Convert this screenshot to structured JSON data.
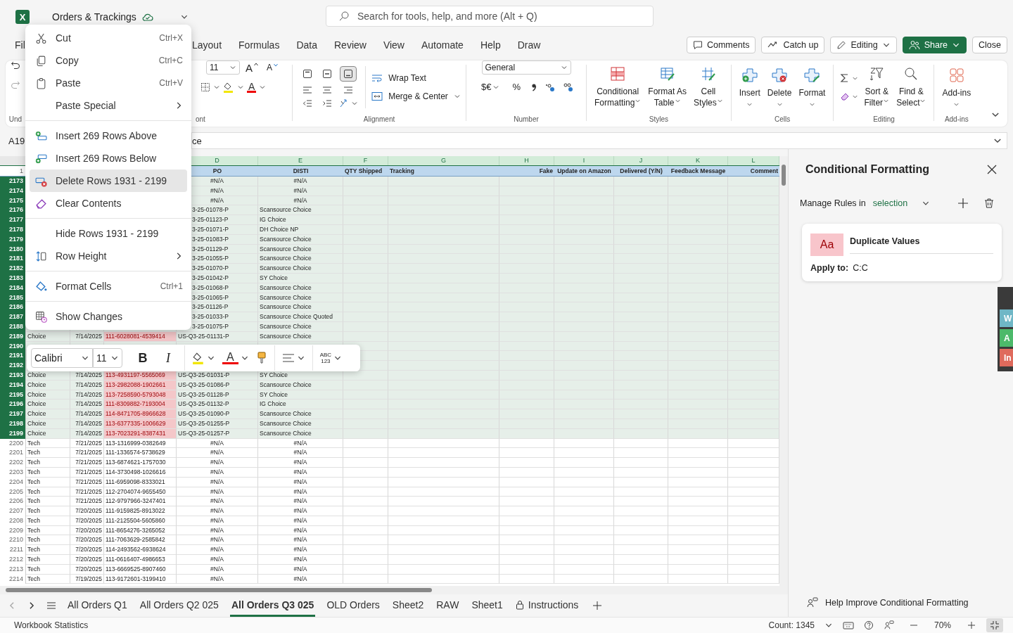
{
  "title_bar": {
    "app_logo": "X",
    "file_name": "Orders & Trackings",
    "search_placeholder": "Search for tools, help, and more (Alt + Q)"
  },
  "menu_tabs": [
    {
      "label": "Fil"
    },
    {
      "label": "Layout"
    },
    {
      "label": "Formulas"
    },
    {
      "label": "Data"
    },
    {
      "label": "Review"
    },
    {
      "label": "View"
    },
    {
      "label": "Automate"
    },
    {
      "label": "Help"
    },
    {
      "label": "Draw"
    }
  ],
  "header_buttons": [
    {
      "label": "Comments",
      "kind": "comments"
    },
    {
      "label": "Catch up",
      "kind": "catchup"
    },
    {
      "label": "Editing",
      "kind": "editing"
    },
    {
      "label": "Share",
      "kind": "share"
    },
    {
      "label": "Close",
      "kind": "close"
    }
  ],
  "ribbon": {
    "undo_label": "Und",
    "font": {
      "size": "11",
      "grow": "A",
      "shrink": "A",
      "color_letter": "A",
      "label": "ont"
    },
    "alignment": {
      "vertical": [
        {
          "selected": false
        },
        {
          "selected": false
        },
        {
          "selected": true
        }
      ],
      "wrap_text": "Wrap Text",
      "merge": "Merge & Center",
      "label": "Alignment"
    },
    "number": {
      "format": "General",
      "currency": "$€",
      "percent": "%",
      "label": "Number"
    },
    "styles": {
      "buttons": [
        {
          "line1": "Conditional",
          "line2": "Formatting"
        },
        {
          "line1": "Format As",
          "line2": "Table"
        },
        {
          "line1": "Cell",
          "line2": "Styles"
        }
      ],
      "label": "Styles"
    },
    "cells": {
      "buttons": [
        "Insert",
        "Delete",
        "Format"
      ],
      "label": "Cells"
    },
    "editing": {
      "buttons": [
        {
          "line1": "Sort &",
          "line2": "Filter"
        },
        {
          "line1": "Find &",
          "line2": "Select"
        }
      ],
      "label": "Editing"
    },
    "addins": {
      "button": "Add-ins",
      "label": "Add-ins"
    }
  },
  "formula_bar": {
    "name_box": "A19",
    "content": "ce"
  },
  "grid": {
    "columns": [
      {
        "letter": "D",
        "heading": "PO"
      },
      {
        "letter": "E",
        "heading": "DISTI"
      },
      {
        "letter": "F",
        "heading": "QTY Shipped"
      },
      {
        "letter": "G",
        "heading": "Tracking"
      },
      {
        "letter": "H",
        "heading": "Fake"
      },
      {
        "letter": "I",
        "heading": "Update on Amazon"
      },
      {
        "letter": "J",
        "heading": "Delivered (Y/N)"
      },
      {
        "letter": "K",
        "heading": "Feedback Message"
      },
      {
        "letter": "L",
        "heading": "Comment"
      }
    ],
    "heading_row_number": "1",
    "rows": [
      {
        "number": "2173",
        "selected": true,
        "na": true,
        "d": "#N/A",
        "e": "#N/A"
      },
      {
        "number": "2174",
        "selected": true,
        "na": true,
        "d": "#N/A",
        "e": "#N/A"
      },
      {
        "number": "2175",
        "selected": true,
        "na": true,
        "d": "#N/A",
        "e": "#N/A"
      },
      {
        "number": "2176",
        "selected": true,
        "na": false,
        "d": "3-25-01078-P",
        "e": "Scansource Choice"
      },
      {
        "number": "2177",
        "selected": true,
        "na": false,
        "d": "3-25-01123-P",
        "e": "IG Choice"
      },
      {
        "number": "2178",
        "selected": true,
        "na": false,
        "d": "3-25-01071-P",
        "e": "DH Choice NP"
      },
      {
        "number": "2179",
        "selected": true,
        "na": false,
        "d": "3-25-01083-P",
        "e": "Scansource Choice"
      },
      {
        "number": "2180",
        "selected": true,
        "na": false,
        "d": "3-25-01129-P",
        "e": "Scansource Choice"
      },
      {
        "number": "2181",
        "selected": true,
        "na": false,
        "d": "3-25-01055-P",
        "e": "Scansource Choice"
      },
      {
        "number": "2182",
        "selected": true,
        "na": false,
        "d": "3-25-01070-P",
        "e": "Scansource Choice"
      },
      {
        "number": "2183",
        "selected": true,
        "na": false,
        "d": "3-25-01042-P",
        "e": "SY Choice"
      },
      {
        "number": "2184",
        "selected": true,
        "na": false,
        "d": "3-25-01068-P",
        "e": "Scansource Choice"
      },
      {
        "number": "2185",
        "selected": true,
        "na": false,
        "d": "3-25-01065-P",
        "e": "Scansource Choice"
      },
      {
        "number": "2186",
        "selected": true,
        "na": false,
        "d": "3-25-01126-P",
        "e": "Scansource Choice"
      },
      {
        "number": "2187",
        "selected": true,
        "na": false,
        "d": "3-25-01033-P",
        "e": "Scansource Choice Quoted"
      },
      {
        "number": "2188",
        "selected": true,
        "na": false,
        "d": "3-25-01075-P",
        "e": "Scansource Choice"
      },
      {
        "number": "2189",
        "selected": true,
        "na": false,
        "a": "Choice",
        "b": "7/14/2025",
        "c": "111-6028081-4539414",
        "c_duplicate": true,
        "d": "US-Q3-25-01131-P",
        "e": "Scansource Choice"
      },
      {
        "number": "2190",
        "selected": true
      },
      {
        "number": "2191",
        "selected": true
      },
      {
        "number": "2192",
        "selected": true
      },
      {
        "number": "2193",
        "selected": true,
        "na": false,
        "a": "Choice",
        "b": "7/14/2025",
        "c": "113-4931197-5565069",
        "c_duplicate": true,
        "d": "US-Q3-25-01031-P",
        "e": "SY Choice"
      },
      {
        "number": "2194",
        "selected": true,
        "na": false,
        "a": "Choice",
        "b": "7/14/2025",
        "c": "113-2982088-1902661",
        "c_duplicate": true,
        "d": "US-Q3-25-01086-P",
        "e": "Scansource Choice"
      },
      {
        "number": "2195",
        "selected": true,
        "na": false,
        "a": "Choice",
        "b": "7/14/2025",
        "c": "113-7258590-5793048",
        "c_duplicate": true,
        "d": "US-Q3-25-01128-P",
        "e": "SY Choice"
      },
      {
        "number": "2196",
        "selected": true,
        "na": false,
        "a": "Choice",
        "b": "7/14/2025",
        "c": "111-8309882-7193004",
        "c_duplicate": true,
        "d": "US-Q3-25-01132-P",
        "e": "IG Choice"
      },
      {
        "number": "2197",
        "selected": true,
        "na": false,
        "a": "Choice",
        "b": "7/14/2025",
        "c": "114-8471705-8966628",
        "c_duplicate": true,
        "d": "US-Q3-25-01090-P",
        "e": "Scansource Choice"
      },
      {
        "number": "2198",
        "selected": true,
        "na": false,
        "a": "Choice",
        "b": "7/14/2025",
        "c": "113-6377335-1006629",
        "c_duplicate": true,
        "d": "US-Q3-25-01255-P",
        "e": "Scansource Choice"
      },
      {
        "number": "2199",
        "selected": true,
        "na": false,
        "a": "Choice",
        "b": "7/14/2025",
        "c": "113-7023291-8387431",
        "c_duplicate": true,
        "d": "US-Q3-25-01257-P",
        "e": "Scansource Choice"
      },
      {
        "number": "2200",
        "selected": false,
        "na": true,
        "a": "Tech",
        "b": "7/21/2025",
        "c": "113-1316999-0382649",
        "c_duplicate": false,
        "d": "#N/A",
        "e": "#N/A"
      },
      {
        "number": "2201",
        "selected": false,
        "na": true,
        "a": "Tech",
        "b": "7/21/2025",
        "c": "111-1336574-5738629",
        "c_duplicate": false,
        "d": "#N/A",
        "e": "#N/A"
      },
      {
        "number": "2202",
        "selected": false,
        "na": true,
        "a": "Tech",
        "b": "7/21/2025",
        "c": "113-6874621-1757030",
        "c_duplicate": false,
        "d": "#N/A",
        "e": "#N/A"
      },
      {
        "number": "2203",
        "selected": false,
        "na": true,
        "a": "Tech",
        "b": "7/21/2025",
        "c": "114-3730498-1026616",
        "c_duplicate": false,
        "d": "#N/A",
        "e": "#N/A"
      },
      {
        "number": "2204",
        "selected": false,
        "na": true,
        "a": "Tech",
        "b": "7/21/2025",
        "c": "111-6959098-8333021",
        "c_duplicate": false,
        "d": "#N/A",
        "e": "#N/A"
      },
      {
        "number": "2205",
        "selected": false,
        "na": true,
        "a": "Tech",
        "b": "7/21/2025",
        "c": "112-2704074-9655450",
        "c_duplicate": false,
        "d": "#N/A",
        "e": "#N/A"
      },
      {
        "number": "2206",
        "selected": false,
        "na": true,
        "a": "Tech",
        "b": "7/21/2025",
        "c": "112-9797966-3247401",
        "c_duplicate": false,
        "d": "#N/A",
        "e": "#N/A"
      },
      {
        "number": "2207",
        "selected": false,
        "na": true,
        "a": "Tech",
        "b": "7/20/2025",
        "c": "111-9159825-8913022",
        "c_duplicate": false,
        "d": "#N/A",
        "e": "#N/A"
      },
      {
        "number": "2208",
        "selected": false,
        "na": true,
        "a": "Tech",
        "b": "7/20/2025",
        "c": "111-2125504-5605860",
        "c_duplicate": false,
        "d": "#N/A",
        "e": "#N/A"
      },
      {
        "number": "2209",
        "selected": false,
        "na": true,
        "a": "Tech",
        "b": "7/20/2025",
        "c": "111-8654276-3265052",
        "c_duplicate": false,
        "d": "#N/A",
        "e": "#N/A"
      },
      {
        "number": "2210",
        "selected": false,
        "na": true,
        "a": "Tech",
        "b": "7/20/2025",
        "c": "111-7063629-2585842",
        "c_duplicate": false,
        "d": "#N/A",
        "e": "#N/A"
      },
      {
        "number": "2211",
        "selected": false,
        "na": true,
        "a": "Tech",
        "b": "7/20/2025",
        "c": "114-2493562-6938624",
        "c_duplicate": false,
        "d": "#N/A",
        "e": "#N/A"
      },
      {
        "number": "2212",
        "selected": false,
        "na": true,
        "a": "Tech",
        "b": "7/20/2025",
        "c": "111-0616407-4986653",
        "c_duplicate": false,
        "d": "#N/A",
        "e": "#N/A"
      },
      {
        "number": "2213",
        "selected": false,
        "na": true,
        "a": "Tech",
        "b": "7/20/2025",
        "c": "113-6669525-8907460",
        "c_duplicate": false,
        "d": "#N/A",
        "e": "#N/A"
      },
      {
        "number": "2214",
        "selected": false,
        "na": true,
        "a": "Tech",
        "b": "7/19/2025",
        "c": "113-9172601-3199410",
        "c_duplicate": false,
        "d": "#N/A",
        "e": "#N/A"
      }
    ]
  },
  "context_menu": {
    "groups": [
      [
        {
          "kind": "cut",
          "label": "Cut",
          "shortcut": "Ctrl+X",
          "submenu": false,
          "highlighted": false
        },
        {
          "kind": "copy",
          "label": "Copy",
          "shortcut": "Ctrl+C",
          "submenu": false,
          "highlighted": false
        },
        {
          "kind": "paste",
          "label": "Paste",
          "shortcut": "Ctrl+V",
          "submenu": false,
          "highlighted": false
        },
        {
          "kind": "blank",
          "label": "Paste Special",
          "submenu": true,
          "highlighted": false
        }
      ],
      [
        {
          "kind": "insert-above",
          "label": "Insert 269 Rows Above",
          "submenu": false,
          "highlighted": false
        },
        {
          "kind": "insert-below",
          "label": "Insert 269 Rows Below",
          "submenu": false,
          "highlighted": false
        },
        {
          "kind": "delete",
          "label": "Delete Rows 1931 - 2199",
          "submenu": false,
          "highlighted": true
        },
        {
          "kind": "clear",
          "label": "Clear Contents",
          "submenu": false,
          "highlighted": false
        }
      ],
      [
        {
          "kind": "blank",
          "label": "Hide Rows 1931 - 2199",
          "submenu": false,
          "highlighted": false
        },
        {
          "kind": "row-height",
          "label": "Row Height",
          "submenu": true,
          "highlighted": false
        }
      ],
      [
        {
          "kind": "format",
          "label": "Format Cells",
          "shortcut": "Ctrl+1",
          "submenu": false,
          "highlighted": false
        }
      ],
      [
        {
          "kind": "changes",
          "label": "Show Changes",
          "submenu": false,
          "highlighted": false
        }
      ]
    ]
  },
  "mini_toolbar": {
    "font": "Calibri",
    "size": "11",
    "bold": "B",
    "italic": "I",
    "color_letter": "A",
    "number_line1": "ABC",
    "number_line2": "123"
  },
  "side_panel": {
    "title": "Conditional Formatting",
    "manage_label": "Manage Rules in",
    "scope": "selection",
    "rules": [
      {
        "swatch": "Aa",
        "name": "Duplicate Values",
        "apply_label": "Apply to:",
        "range": "C:C"
      }
    ],
    "footer_link": "Help Improve Conditional Formatting"
  },
  "edge_overlay": {
    "tabs": [
      {
        "label": "W",
        "color": "#6fb7c6"
      },
      {
        "label": "A",
        "color": "#4cb96a"
      },
      {
        "label": "In",
        "color": "#df6a5c"
      }
    ]
  },
  "sheet_tabs": [
    {
      "label": "All Orders Q1",
      "selected": false,
      "locked": false
    },
    {
      "label": "All Orders Q2 025",
      "selected": false,
      "locked": false
    },
    {
      "label": "All Orders Q3 025",
      "selected": true,
      "locked": false
    },
    {
      "label": "OLD Orders",
      "selected": false,
      "locked": false
    },
    {
      "label": "Sheet2",
      "selected": false,
      "locked": false
    },
    {
      "label": "RAW",
      "selected": false,
      "locked": false
    },
    {
      "label": "Sheet1",
      "selected": false,
      "locked": false
    },
    {
      "label": "Instructions",
      "selected": false,
      "locked": true
    }
  ],
  "status_bar": {
    "left": "Workbook Statistics",
    "count": "Count: 1345",
    "zoom": "70%"
  }
}
